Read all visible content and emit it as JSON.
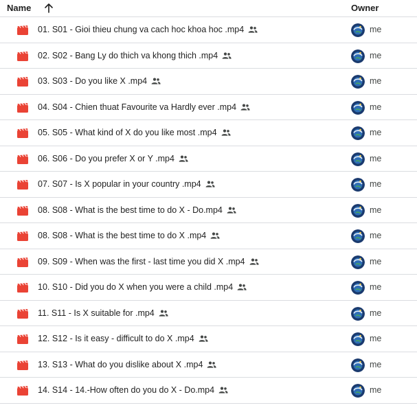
{
  "header": {
    "name_label": "Name",
    "owner_label": "Owner",
    "sort_icon": "arrow-up-icon"
  },
  "colors": {
    "video_icon": "#ea4335",
    "divider": "#dadce0",
    "avatar_bg": "#1a3a6e"
  },
  "files": [
    {
      "name": "01. S01 - Gioi thieu chung va cach hoc khoa hoc .mp4",
      "owner": "me",
      "shared": true,
      "icon": "video-file-icon"
    },
    {
      "name": "02. S02 - Bang Ly do thich va khong thich .mp4",
      "owner": "me",
      "shared": true,
      "icon": "video-file-icon"
    },
    {
      "name": "03. S03 - Do you like X .mp4",
      "owner": "me",
      "shared": true,
      "icon": "video-file-icon"
    },
    {
      "name": "04. S04 - Chien thuat Favourite va Hardly ever .mp4",
      "owner": "me",
      "shared": true,
      "icon": "video-file-icon"
    },
    {
      "name": "05. S05 - What kind of X do you like most .mp4",
      "owner": "me",
      "shared": true,
      "icon": "video-file-icon"
    },
    {
      "name": "06. S06 - Do you prefer X or Y .mp4",
      "owner": "me",
      "shared": true,
      "icon": "video-file-icon"
    },
    {
      "name": "07. S07 - Is X popular in your country .mp4",
      "owner": "me",
      "shared": true,
      "icon": "video-file-icon"
    },
    {
      "name": "08. S08 - What is the best time to do X - Do.mp4",
      "owner": "me",
      "shared": true,
      "icon": "video-file-icon"
    },
    {
      "name": "08. S08 - What is the best time to do X .mp4",
      "owner": "me",
      "shared": true,
      "icon": "video-file-icon"
    },
    {
      "name": "09. S09 - When was the first - last time you did X .mp4",
      "owner": "me",
      "shared": true,
      "icon": "video-file-icon"
    },
    {
      "name": "10. S10 - Did you do X when you were a child .mp4",
      "owner": "me",
      "shared": true,
      "icon": "video-file-icon"
    },
    {
      "name": "11. S11 - Is X suitable for .mp4",
      "owner": "me",
      "shared": true,
      "icon": "video-file-icon"
    },
    {
      "name": "12. S12 - Is it easy - difficult to do X .mp4",
      "owner": "me",
      "shared": true,
      "icon": "video-file-icon"
    },
    {
      "name": "13. S13 - What do you dislike about X .mp4",
      "owner": "me",
      "shared": true,
      "icon": "video-file-icon"
    },
    {
      "name": "14. S14 - 14.-How often do you do X - Do.mp4",
      "owner": "me",
      "shared": true,
      "icon": "video-file-icon"
    }
  ]
}
